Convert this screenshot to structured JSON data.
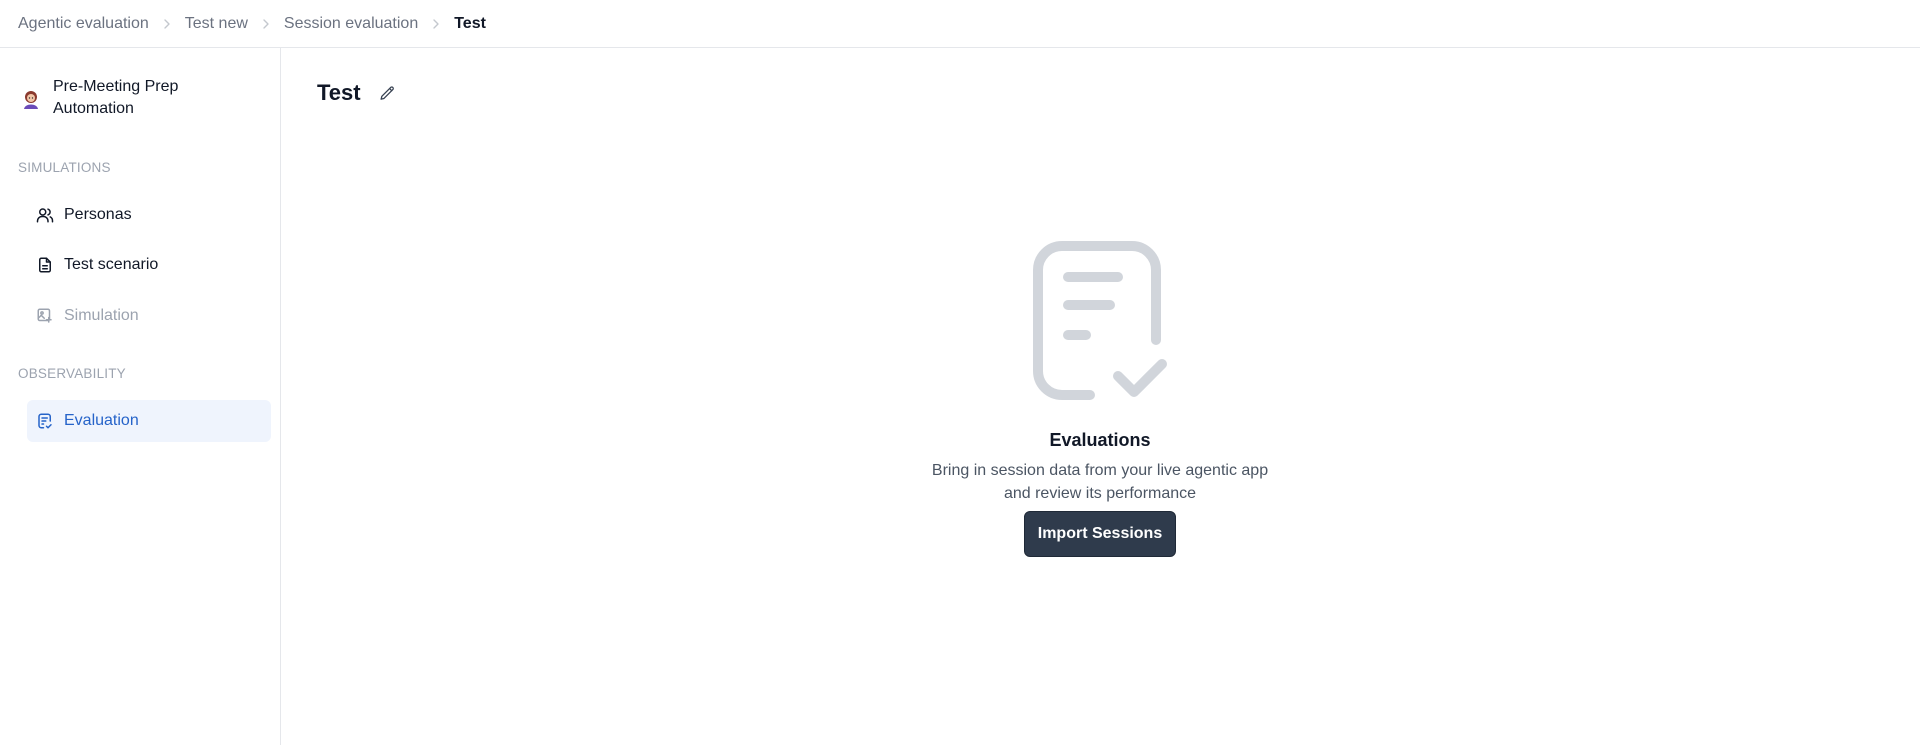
{
  "breadcrumb": {
    "items": [
      "Agentic evaluation",
      "Test new",
      "Session evaluation",
      "Test"
    ]
  },
  "sidebar": {
    "project_name": "Pre-Meeting Prep Automation",
    "sections": [
      {
        "label": "SIMULATIONS",
        "items": [
          {
            "label": "Personas",
            "icon": "users-icon",
            "state": "normal"
          },
          {
            "label": "Test scenario",
            "icon": "document-icon",
            "state": "normal"
          },
          {
            "label": "Simulation",
            "icon": "simulation-icon",
            "state": "disabled"
          }
        ]
      },
      {
        "label": "OBSERVABILITY",
        "items": [
          {
            "label": "Evaluation",
            "icon": "evaluation-icon",
            "state": "active"
          }
        ]
      }
    ]
  },
  "main": {
    "title": "Test",
    "empty_state": {
      "icon": "document-check-icon",
      "title": "Evaluations",
      "description": "Bring in session data from your live agentic app and review its performance",
      "button_label": "Import Sessions"
    }
  },
  "colors": {
    "accent": "#2563c9",
    "active_bg": "#eff4fd",
    "primary_button": "#2f3b4c",
    "muted": "#9ca3af"
  }
}
